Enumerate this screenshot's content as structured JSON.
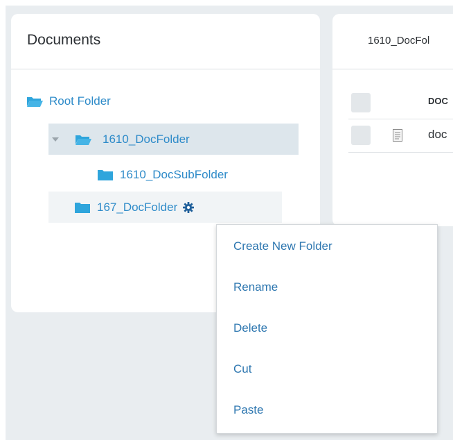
{
  "left_panel": {
    "title": "Documents",
    "tree": {
      "root": "Root Folder",
      "folder_1610": "1610_DocFolder",
      "subfolder_1610": "1610_DocSubFolder",
      "folder_167": "167_DocFolder"
    }
  },
  "right_panel": {
    "title": "1610_DocFol",
    "column_header": "DOC",
    "row_text": "doc"
  },
  "context_menu": {
    "items": [
      "Create New Folder",
      "Rename",
      "Delete",
      "Cut",
      "Paste"
    ]
  },
  "colors": {
    "accent": "#2e8bc9",
    "folder": "#2fa5dc",
    "highlight": "#dde6ec",
    "background": "#e9edf0"
  },
  "icons": {
    "root": "folder-open-icon",
    "folder_1610": "folder-open-icon",
    "subfolder": "folder-icon",
    "folder_167": "folder-icon",
    "settings": "gear-icon",
    "document": "document-icon",
    "expand": "caret-down-icon"
  }
}
